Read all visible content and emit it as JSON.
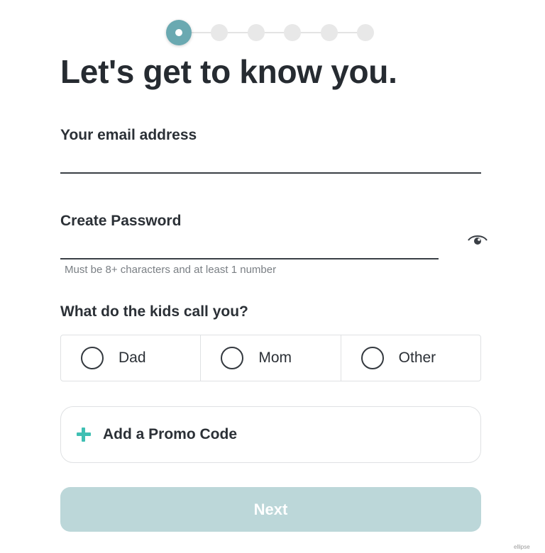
{
  "stepper": {
    "total_steps": 6,
    "current_step": 1
  },
  "title": "Let's get to know you.",
  "email": {
    "label": "Your email address",
    "value": "",
    "placeholder": ""
  },
  "password": {
    "label": "Create Password",
    "value": "",
    "placeholder": "",
    "hint": "Must be 8+ characters and at least 1 number",
    "toggle_icon": "eye-icon"
  },
  "kids_call": {
    "label": "What do the kids call you?",
    "options": [
      "Dad",
      "Mom",
      "Other"
    ]
  },
  "promo": {
    "label": "Add a Promo Code",
    "icon": "plus-icon"
  },
  "next_label": "Next",
  "watermark": "ellipse",
  "colors": {
    "accent": "#6aa9b1",
    "plus": "#3fbfb3",
    "next_button_disabled": "#bcd7d9",
    "text": "#2b3036"
  }
}
